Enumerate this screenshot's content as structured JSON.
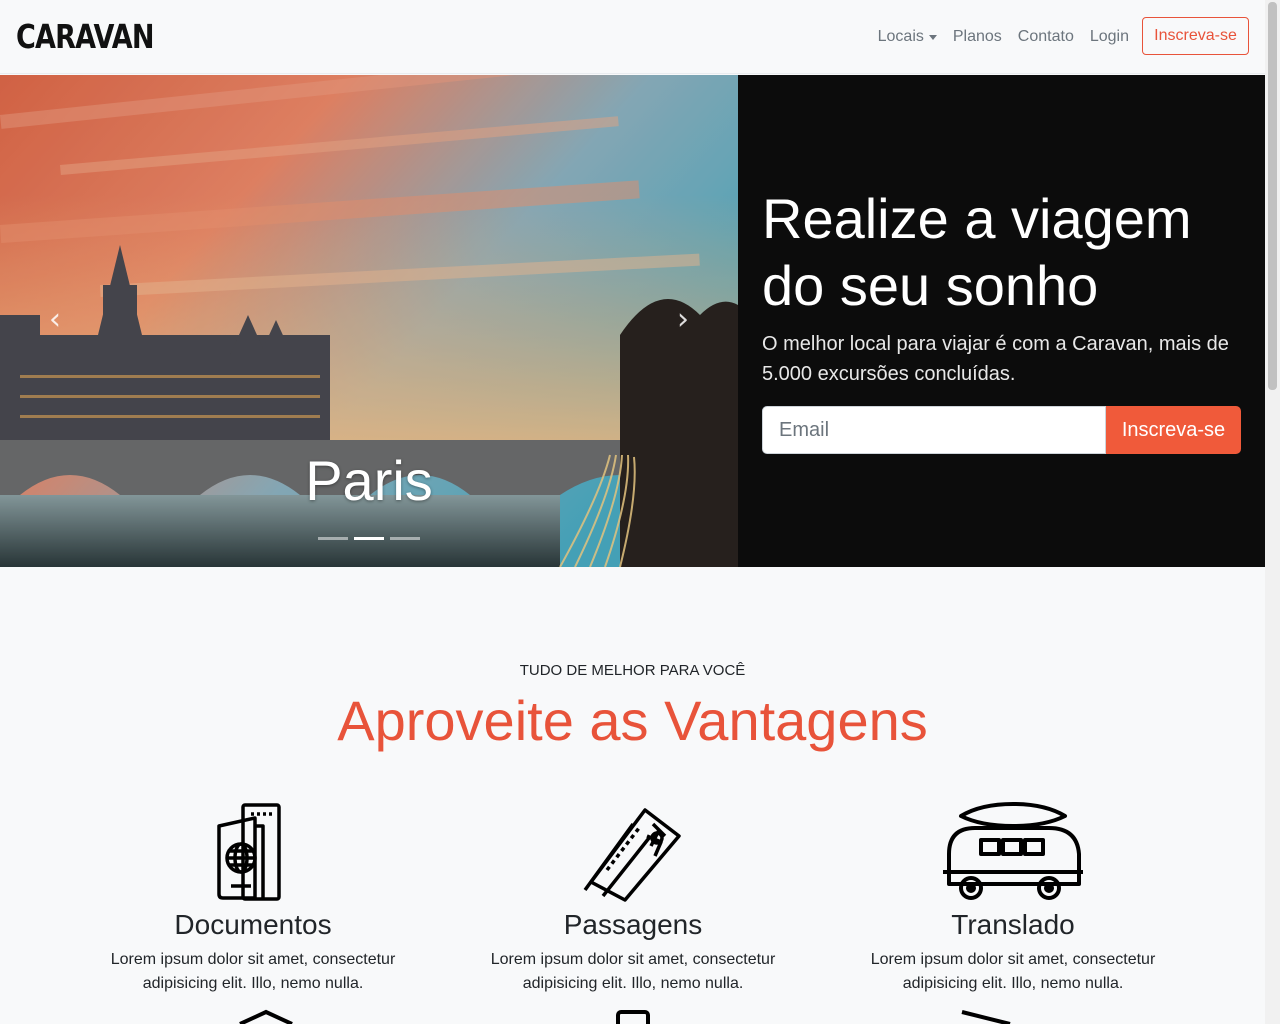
{
  "nav": {
    "logo": "CARAVAN",
    "links": [
      {
        "label": "Locais",
        "dropdown": true
      },
      {
        "label": "Planos"
      },
      {
        "label": "Contato"
      },
      {
        "label": "Login"
      }
    ],
    "cta": "Inscreva-se"
  },
  "hero": {
    "carousel": {
      "caption": "Paris",
      "slide_count": 3,
      "active_slide": 2,
      "prev_icon": "chevron-left-icon",
      "next_icon": "chevron-right-icon"
    },
    "title": "Realize a viagem do seu sonho",
    "text": "O melhor local para viajar é com a Caravan, mais de 5.000 excursões concluídas.",
    "email_placeholder": "Email",
    "submit_label": "Inscreva-se"
  },
  "features": {
    "eyebrow": "TUDO DE MELHOR PARA VOCÊ",
    "title": "Aproveite as Vantagens",
    "items": [
      {
        "icon": "passport-icon",
        "title": "Documentos",
        "text": "Lorem ipsum dolor sit amet, consectetur adipisicing elit. Illo, nemo nulla."
      },
      {
        "icon": "plane-ticket-icon",
        "title": "Passagens",
        "text": "Lorem ipsum dolor sit amet, consectetur adipisicing elit. Illo, nemo nulla."
      },
      {
        "icon": "van-icon",
        "title": "Translado",
        "text": "Lorem ipsum dolor sit amet, consectetur adipisicing elit. Illo, nemo nulla."
      }
    ]
  },
  "colors": {
    "accent": "#e8533a",
    "button": "#f05a3a",
    "hero_panel": "#0c0c0c",
    "background": "#f8f9fa"
  }
}
